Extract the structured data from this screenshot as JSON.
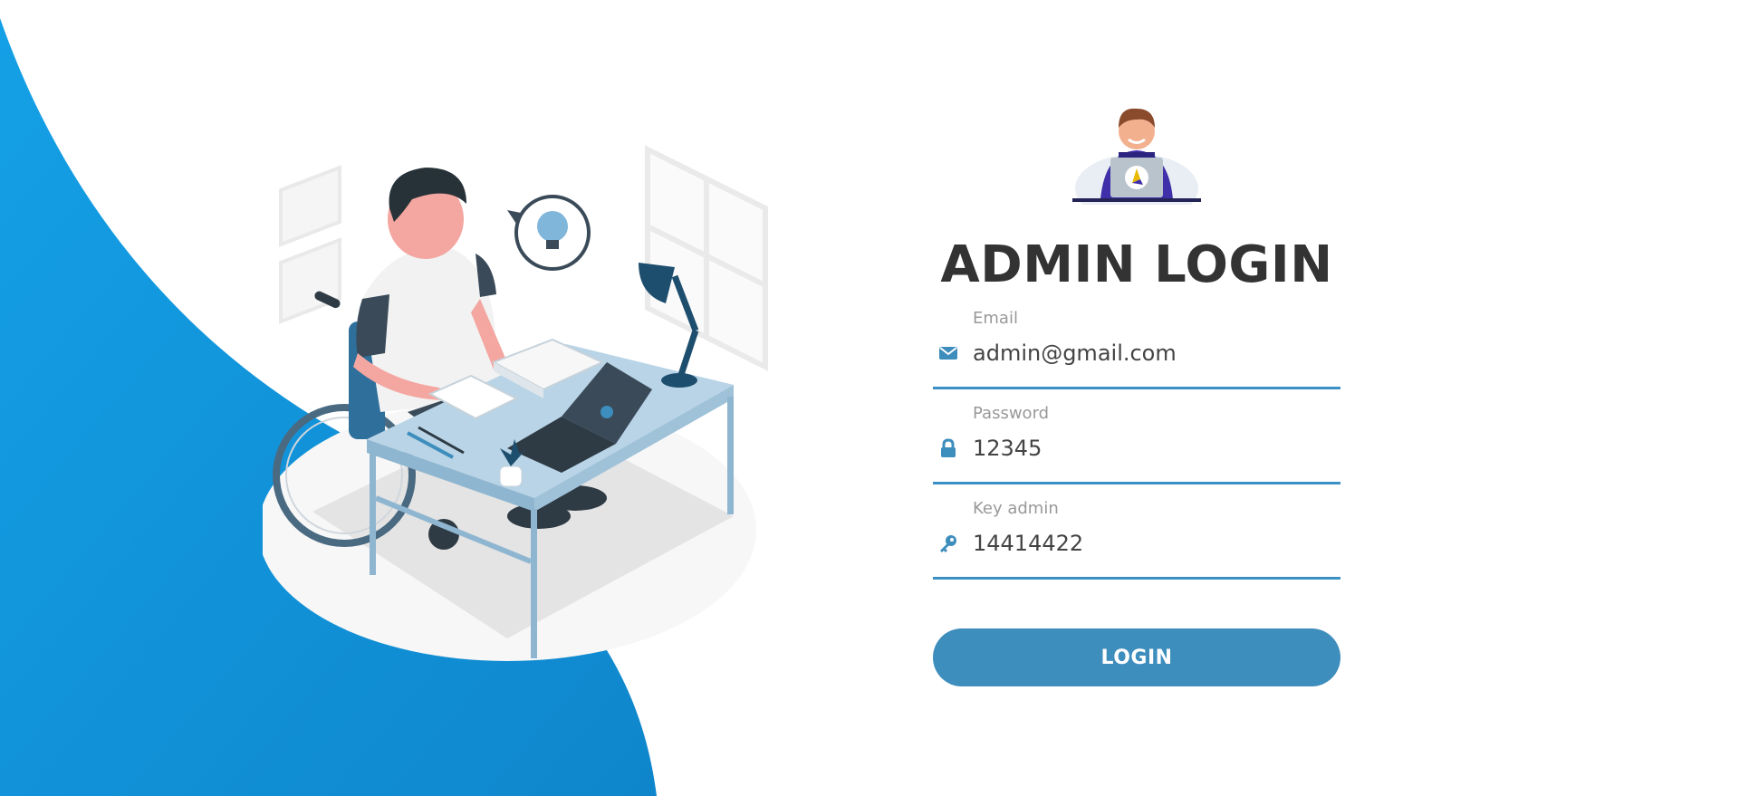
{
  "colors": {
    "wave_blue": "#1199dd",
    "wave_blue_dark": "#0f7bc0",
    "accent": "#3d8dbd",
    "title": "#333333",
    "label": "#999999",
    "input_text": "#444444"
  },
  "illustration": {
    "icon": "person-in-wheelchair-at-desk-illustration"
  },
  "login": {
    "avatar_icon": "admin-avatar-icon",
    "title": "ADMIN LOGIN",
    "fields": [
      {
        "label": "Email",
        "value": "admin@gmail.com",
        "icon": "envelope-icon"
      },
      {
        "label": "Password",
        "value": "12345",
        "icon": "lock-icon"
      },
      {
        "label": "Key admin",
        "value": "14414422",
        "icon": "key-icon"
      }
    ],
    "submit_label": "LOGIN"
  }
}
